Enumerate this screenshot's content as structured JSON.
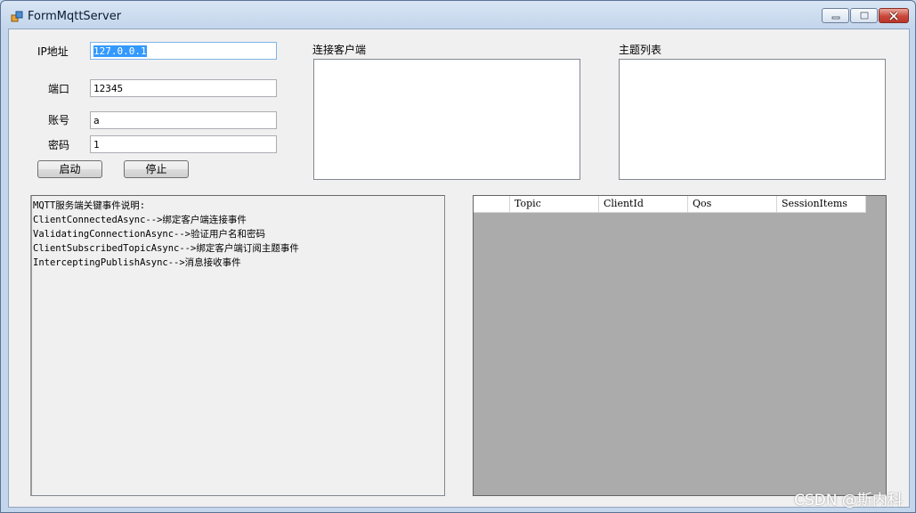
{
  "window": {
    "title": "FormMqttServer",
    "controls": {
      "minimize": "minimize",
      "maximize": "maximize",
      "close": "close"
    }
  },
  "form": {
    "ip_label": "IP地址",
    "ip_value": "127.0.0.1",
    "port_label": "端口",
    "port_value": "12345",
    "account_label": "账号",
    "account_value": "a",
    "password_label": "密码",
    "password_value": "1",
    "start_label": "启动",
    "stop_label": "停止"
  },
  "clients": {
    "label": "连接客户端",
    "items": []
  },
  "topics": {
    "label": "主题列表",
    "items": []
  },
  "log": {
    "lines": [
      "MQTT服务端关键事件说明:",
      "ClientConnectedAsync-->绑定客户端连接事件",
      "ValidatingConnectionAsync-->验证用户名和密码",
      "ClientSubscribedTopicAsync-->绑定客户端订阅主题事件",
      "InterceptingPublishAsync-->消息接收事件"
    ]
  },
  "grid": {
    "columns": [
      "",
      "Topic",
      "ClientId",
      "Qos",
      "SessionItems"
    ],
    "rows": []
  },
  "watermark": "CSDN @斯内科",
  "colors": {
    "selection": "#3399ff",
    "grid_background": "#ababab",
    "form_background": "#f0f0f0"
  }
}
